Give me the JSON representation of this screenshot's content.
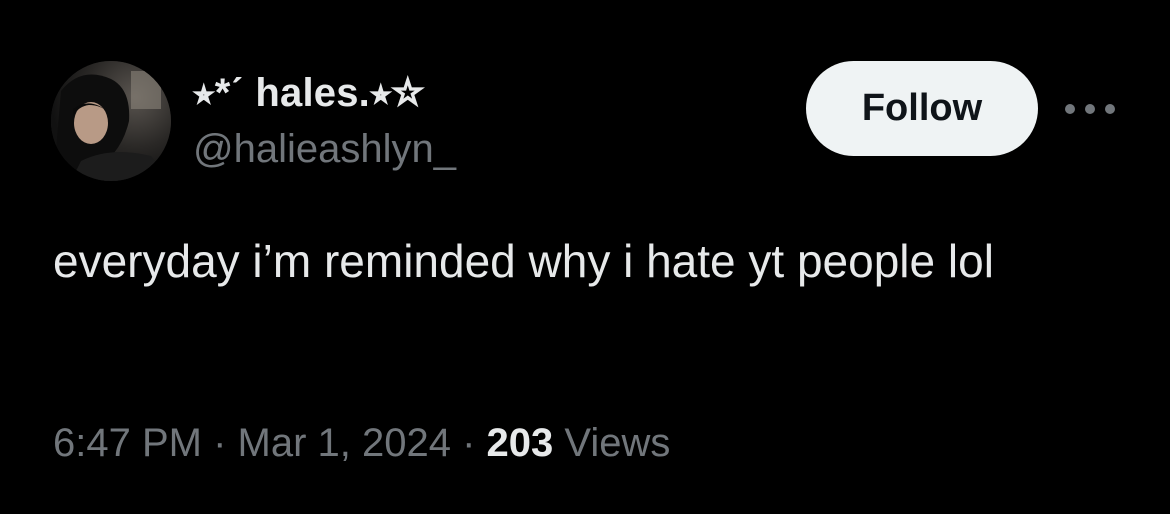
{
  "user": {
    "display_name": "⭒*ˊ hales.⭒☆",
    "handle": "@halieashlyn_"
  },
  "follow_label": "Follow",
  "tweet": {
    "text": "everyday i’m reminded why i hate yt people lol",
    "time": "6:47 PM",
    "separator_1": " · ",
    "date": "Mar 1, 2024",
    "separator_2": " · ",
    "views_count": "203",
    "views_label": " Views"
  },
  "colors": {
    "background": "#000000",
    "primary_text": "#e7e9ea",
    "secondary_text": "#71767b",
    "follow_button_bg": "#eff3f4",
    "follow_button_text": "#0f1419"
  },
  "icons": {
    "more": "more-horizontal-icon"
  }
}
